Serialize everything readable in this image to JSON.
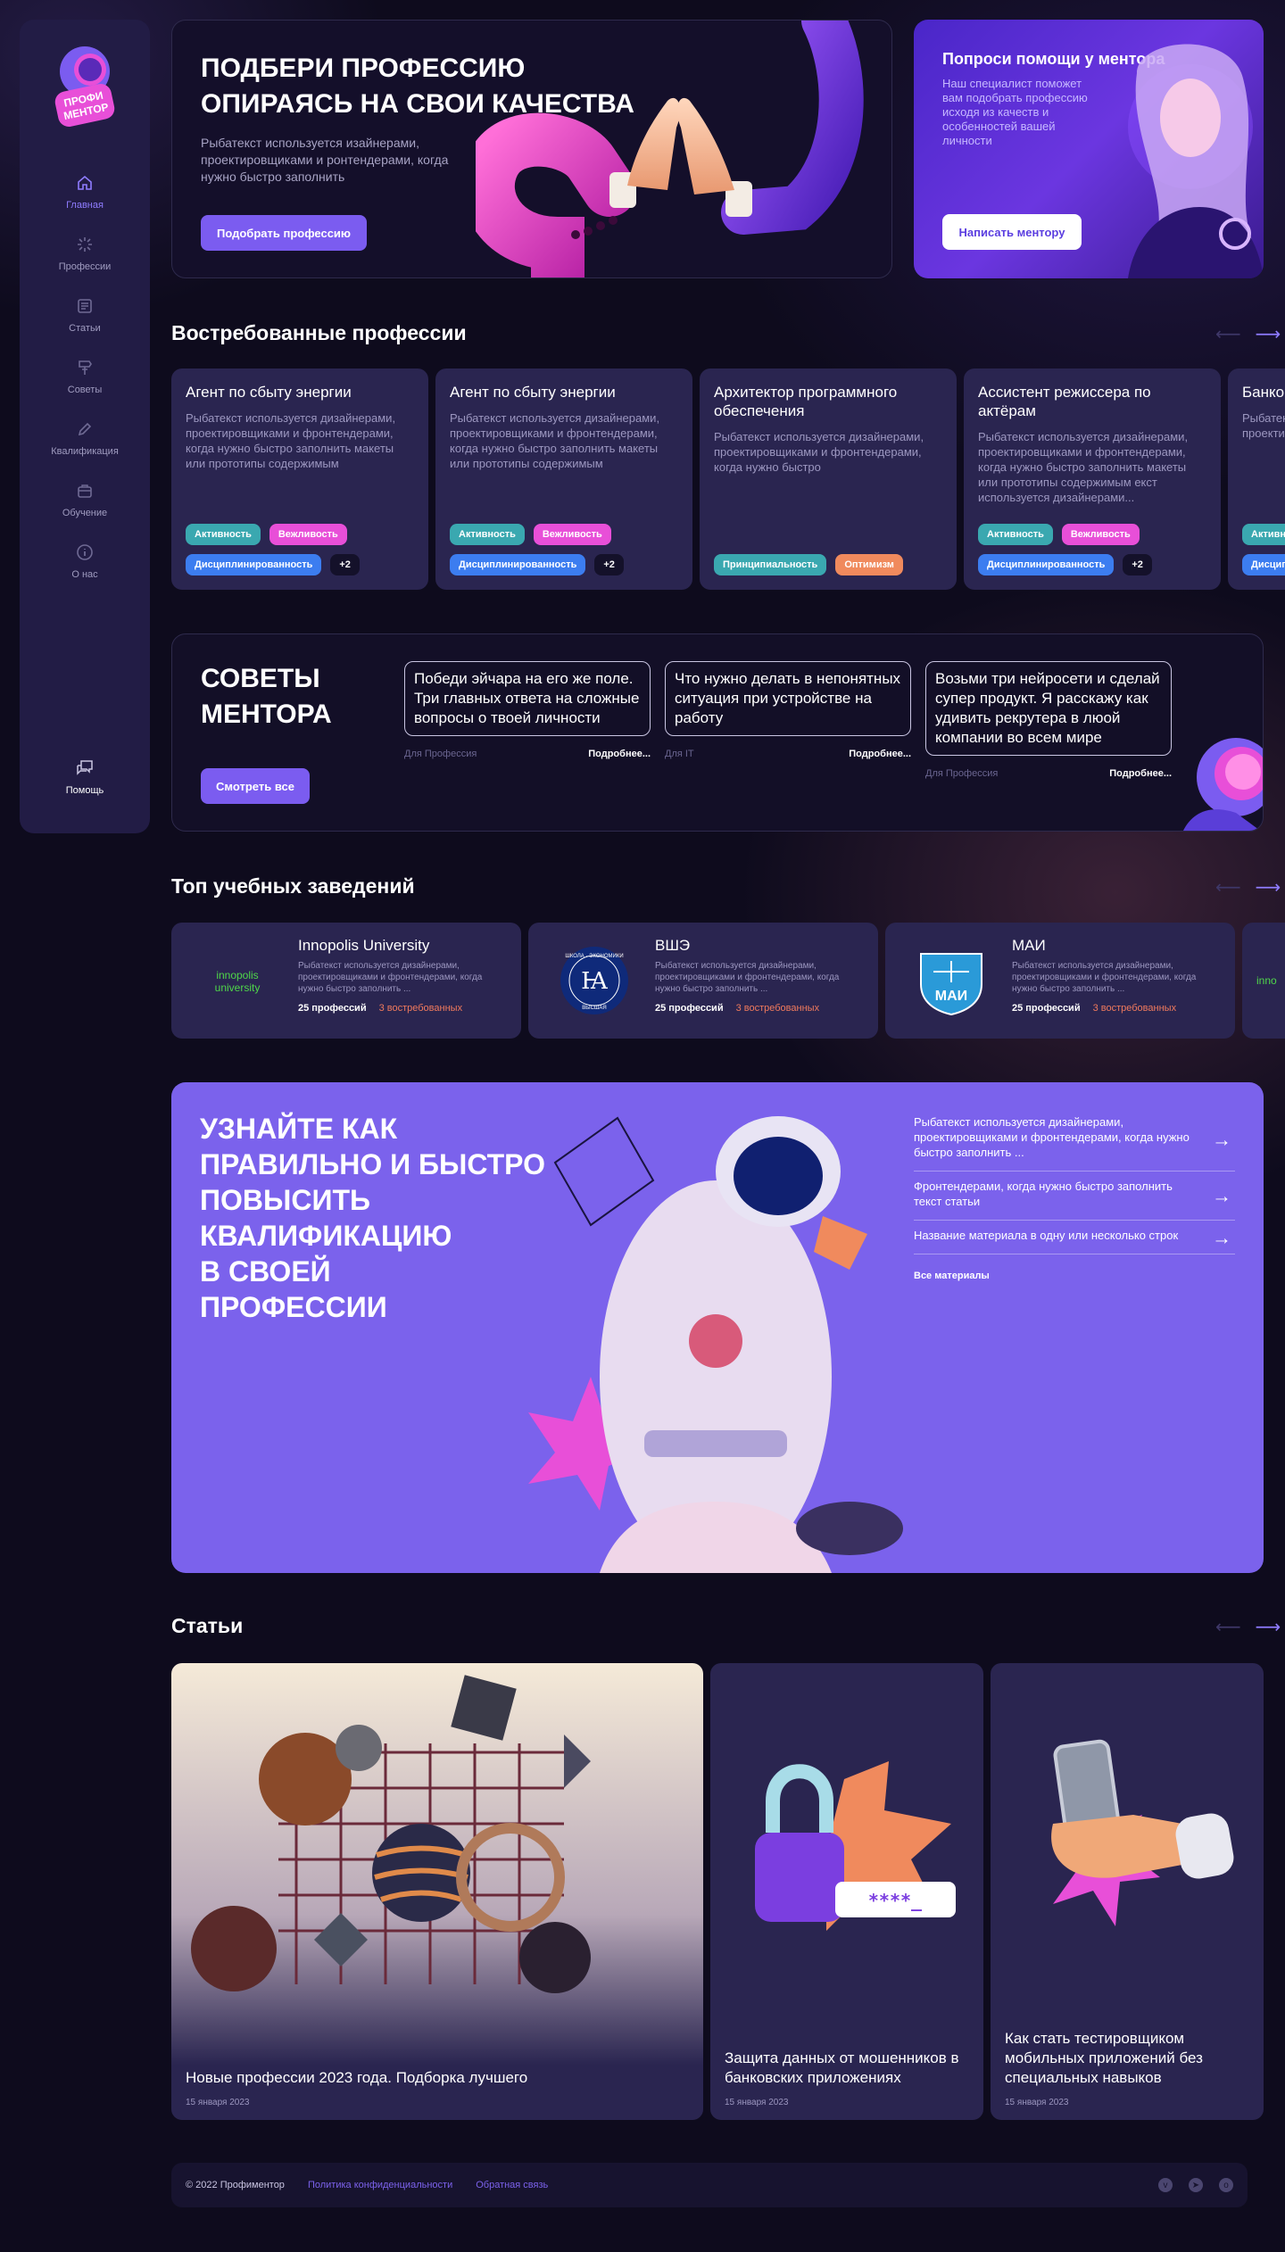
{
  "brand": {
    "logo_text": "ПРОФИ МЕНТОР"
  },
  "sidebar": {
    "items": [
      {
        "label": "Главная",
        "icon": "home-icon",
        "active": true
      },
      {
        "label": "Профессии",
        "icon": "sparkle-icon"
      },
      {
        "label": "Статьи",
        "icon": "document-icon"
      },
      {
        "label": "Советы",
        "icon": "signpost-icon"
      },
      {
        "label": "Квалификация",
        "icon": "pen-icon"
      },
      {
        "label": "Обучение",
        "icon": "briefcase-icon"
      },
      {
        "label": "О нас",
        "icon": "info-icon"
      }
    ],
    "help": {
      "label": "Помощь",
      "icon": "chat-icon"
    }
  },
  "hero": {
    "title": "ПОДБЕРИ ПРОФЕССИЮ\nОПИРАЯСЬ НА СВОИ КАЧЕСТВА",
    "text": "Рыбатекст используется изайнерами, проектировщиками и ронтендерами, когда нужно быстро заполнить",
    "button": "Подобрать профессию"
  },
  "mentor": {
    "title": "Попроси помощи у ментора",
    "text": "Наш специалист поможет вам подобрать профессию исходя из качеств и особенностей вашей личности",
    "button": "Написать ментору"
  },
  "professions": {
    "title": "Востребованные профессии",
    "cards": [
      {
        "title": "Агент по сбыту энергии",
        "text": "Рыбатекст используется дизайнерами, проектировщиками и фронтендерами, когда нужно быстро заполнить макеты или прототипы содержимым",
        "tags": [
          "Активность",
          "Вежливость",
          "Дисциплинированность",
          "+2"
        ]
      },
      {
        "title": "Агент по сбыту энергии",
        "text": "Рыбатекст используется дизайнерами, проектировщиками и фронтендерами, когда нужно быстро заполнить макеты или прототипы содержимым",
        "tags": [
          "Активность",
          "Вежливость",
          "Дисциплинированность",
          "+2"
        ]
      },
      {
        "title": "Архитектор программного обеспечения",
        "text": "Рыбатекст используется дизайнерами, проектировщиками и фронтендерами, когда нужно быстро",
        "tags": [
          "Принципиальность",
          "Оптимизм"
        ]
      },
      {
        "title": "Ассистент режиссера по актёрам",
        "text": "Рыбатекст используется дизайнерами, проектировщиками и фронтендерами, когда нужно быстро заполнить макеты или прототипы содержимым екст используется дизайнерами...",
        "tags": [
          "Активность",
          "Вежливость",
          "Дисциплинированность",
          "+2"
        ]
      },
      {
        "title": "Банковский операционист",
        "text": "Рыбатекст используется дизайнерами, проектировщиками",
        "tags": [
          "Активность",
          "Дисциплинированность"
        ]
      }
    ]
  },
  "tips": {
    "title": "СОВЕТЫ\nМЕНТОРА",
    "button": "Смотреть все",
    "items": [
      {
        "text": "Победи эйчара на его же поле. Три главных ответа на сложные вопросы о твоей личности",
        "category": "Для Профессия",
        "more": "Подробнее..."
      },
      {
        "text": "Что нужно делать в непонятных ситуация при устройстве на работу",
        "category": "Для IT",
        "more": "Подробнее..."
      },
      {
        "text": "Возьми три нейросети и сделай супер продукт. Я расскажу как удивить рекрутера в люой компании во всем мире",
        "category": "Для Профессия",
        "more": "Подробнее..."
      }
    ]
  },
  "universities": {
    "title": "Топ учебных заведений",
    "cards": [
      {
        "name": "Innopolis University",
        "logo": "innopolis university",
        "text": "Рыбатекст используется дизайнерами, проектировщиками и фронтендерами, когда нужно быстро заполнить ...",
        "count": "25 профессий",
        "demand": "3 востребованных"
      },
      {
        "name": "ВШЭ",
        "logo": "ШКОЛА · ЭКОНОМИКИ · ВЫСШАЯ",
        "text": "Рыбатекст используется дизайнерами, проектировщиками и фронтендерами, когда нужно быстро заполнить ...",
        "count": "25 профессий",
        "demand": "3 востребованных"
      },
      {
        "name": "МАИ",
        "logo": "МАИ",
        "text": "Рыбатекст используется дизайнерами, проектировщиками и фронтендерами, когда нужно быстро заполнить ...",
        "count": "25 профессий",
        "demand": "3 востребованных"
      },
      {
        "name": "",
        "logo": "innopolis",
        "text": "",
        "count": "",
        "demand": ""
      }
    ]
  },
  "promo": {
    "title": "УЗНАЙТЕ КАК\nПРАВИЛЬНО И БЫСТРО\nПОВЫСИТЬ\nКВАЛИФИКАЦИЮ\nВ СВОЕЙ\nПРОФЕССИИ",
    "items": [
      "Рыбатекст используется дизайнерами, проектировщиками и фронтендерами, когда нужно быстро заполнить ...",
      "Фронтендерами, когда нужно быстро заполнить текст статьи",
      "Название материала в одну или несколько строк"
    ],
    "all_link": "Все материалы"
  },
  "articles": {
    "title": "Статьи",
    "cards": [
      {
        "title": "Новые профессии 2023 года. Подборка лучшего",
        "date": "15 января 2023"
      },
      {
        "title": "Защита данных от мошенников в банковских приложениях",
        "date": "15 января 2023"
      },
      {
        "title": "Как стать тестировщиком мобильных приложений без специальных навыков",
        "date": "15 января 2023"
      }
    ]
  },
  "footer": {
    "copyright": "© 2022 Профиментор",
    "links": [
      "Политика конфиденциальности",
      "Обратная связь"
    ],
    "socials": [
      "vk-icon",
      "telegram-icon",
      "odnoklassniki-icon"
    ]
  },
  "colors": {
    "accent": "#7b5cf0",
    "background": "#0e0b1d",
    "card": "#2a2550"
  }
}
